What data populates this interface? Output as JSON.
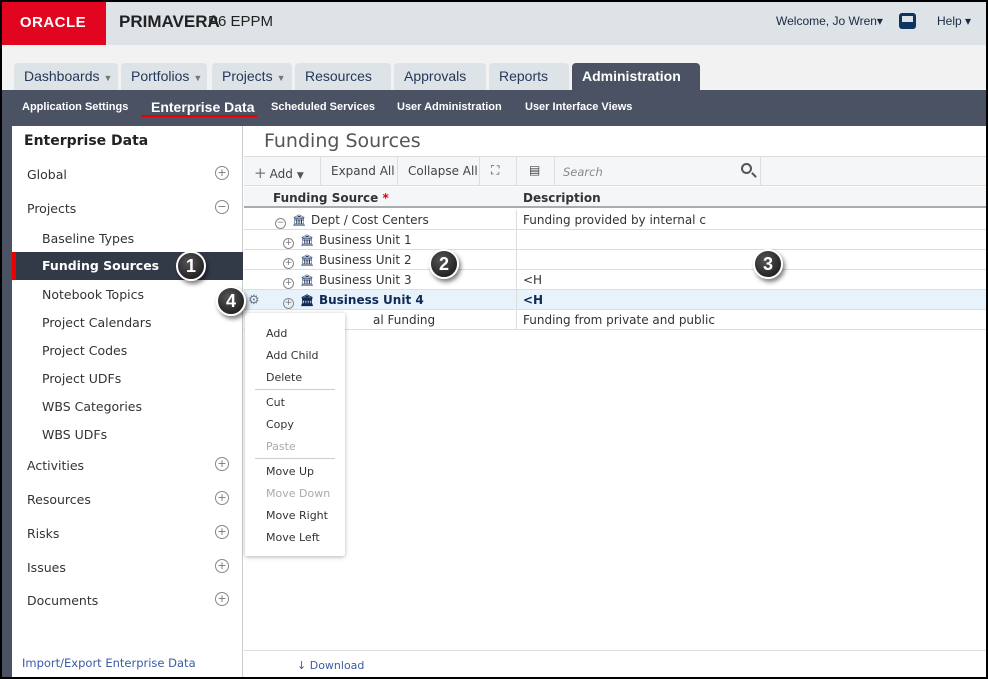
{
  "header": {
    "logo": "ORACLE",
    "brand": "PRIMAVERA",
    "brand_sub": "P6 EPPM",
    "welcome": "Welcome, Jo Wren▾",
    "help": "Help ▾"
  },
  "tabs": [
    {
      "label": "Dashboards",
      "dropdown": true
    },
    {
      "label": "Portfolios",
      "dropdown": true
    },
    {
      "label": "Projects",
      "dropdown": true
    },
    {
      "label": "Resources",
      "dropdown": false
    },
    {
      "label": "Approvals",
      "dropdown": false
    },
    {
      "label": "Reports",
      "dropdown": false
    },
    {
      "label": "Administration",
      "dropdown": false,
      "active": true
    }
  ],
  "subnav": [
    {
      "label": "Application Settings"
    },
    {
      "label": "Enterprise Data",
      "active": true
    },
    {
      "label": "Scheduled Services"
    },
    {
      "label": "User Administration"
    },
    {
      "label": "User Interface Views"
    }
  ],
  "sidebar": {
    "title": "Enterprise Data",
    "global": "Global",
    "projects": "Projects",
    "project_items": [
      "Baseline Types",
      "Funding Sources",
      "Notebook Topics",
      "Project Calendars",
      "Project Codes",
      "Project UDFs",
      "WBS Categories",
      "WBS UDFs"
    ],
    "selected": "Funding Sources",
    "groups": [
      "Activities",
      "Resources",
      "Risks",
      "Issues",
      "Documents"
    ],
    "footer_link": "Import/Export Enterprise Data"
  },
  "main": {
    "title": "Funding Sources",
    "toolbar": {
      "add": "Add",
      "expand_all": "Expand All",
      "collapse_all": "Collapse All",
      "search_placeholder": "Search"
    },
    "columns": {
      "funding_source": "Funding Source",
      "required_mark": "*",
      "description": "Description"
    },
    "rows": [
      {
        "name": "Dept / Cost Centers",
        "description": "Funding provided by internal c",
        "toggle": "⊖"
      },
      {
        "name": "Business Unit 1",
        "description": "",
        "toggle": "⊕"
      },
      {
        "name": "Business Unit 2",
        "description": "",
        "toggle": "⊕"
      },
      {
        "name": "Business Unit 3",
        "description": "<H",
        "toggle": "⊕"
      },
      {
        "name": "Business Unit 4",
        "description": "<H",
        "toggle": "⊕",
        "selected": true
      },
      {
        "name": "al Funding",
        "description": "Funding from private and public"
      }
    ],
    "context_menu": [
      {
        "label": "Add",
        "enabled": true
      },
      {
        "label": "Add Child",
        "enabled": true
      },
      {
        "label": "Delete",
        "enabled": true
      },
      {
        "label": "Cut",
        "enabled": true
      },
      {
        "label": "Copy",
        "enabled": true
      },
      {
        "label": "Paste",
        "enabled": false
      },
      {
        "label": "Move Up",
        "enabled": true
      },
      {
        "label": "Move Down",
        "enabled": false
      },
      {
        "label": "Move Right",
        "enabled": true
      },
      {
        "label": "Move Left",
        "enabled": true
      }
    ],
    "download": "Download"
  },
  "callouts": [
    "1",
    "2",
    "3",
    "4"
  ]
}
